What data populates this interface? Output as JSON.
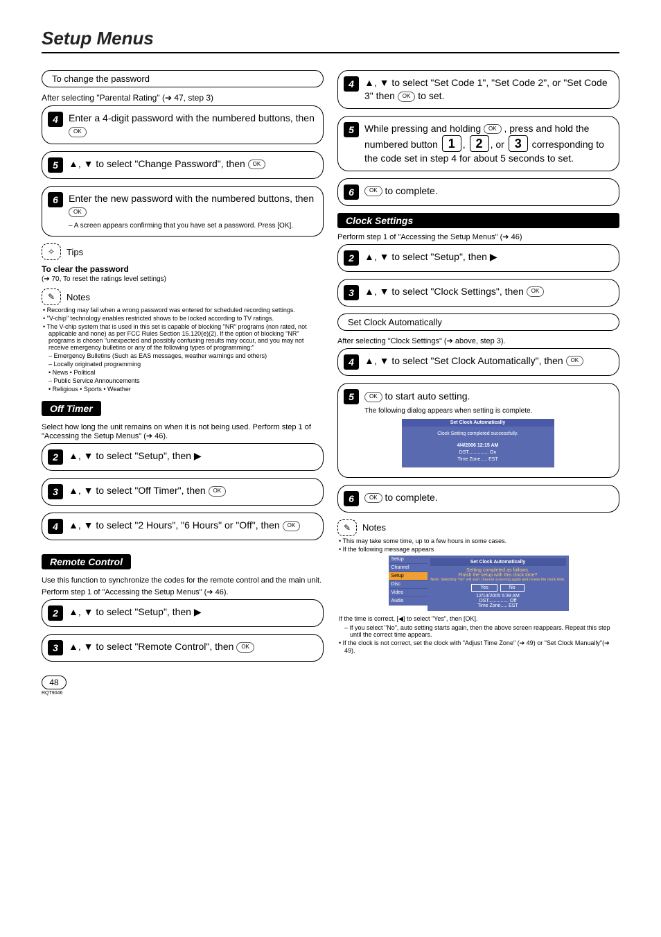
{
  "page": {
    "title": "Setup Menus",
    "number": "48",
    "footer_code": "RQT9046"
  },
  "left": {
    "change_pw_header": "To change the password",
    "change_pw_after": "After selecting \"Parental Rating\" (➔ 47, step 3)",
    "step4": "Enter a 4-digit password with the numbered buttons, then ",
    "step5": "▲, ▼ to select \"Change Password\", then ",
    "step6": "Enter the new password with the numbered buttons, then ",
    "step6_sub": "– A screen appears confirming that you have set a password. Press [OK].",
    "tips_label": "Tips",
    "tips_title": "To clear the password",
    "tips_body": "(➔ 70, To reset the ratings level settings)",
    "notes_label": "Notes",
    "notes": [
      "Recording may fail when a wrong password was entered for scheduled recording settings.",
      "\"V-chip\" technology enables restricted shows to be locked according to TV ratings.",
      "The V-chip system that is used in this set is capable of blocking \"NR\" programs (non rated, not applicable and none) as per FCC Rules Section 15.120(e)(2). If the option of blocking \"NR\" programs is chosen \"unexpected and possibly confusing results may occur, and you may not receive emergency bulletins or any of the following types of programming:\""
    ],
    "notes_sub": [
      "Emergency Bulletins (Such as EAS messages, weather warnings and others)",
      "Locally originated programming",
      "News • Political",
      "Public Service Announcements",
      "Religious • Sports • Weather"
    ],
    "off_timer_title": "Off Timer",
    "off_timer_intro": "Select how long the unit remains on when it is not being used. Perform step 1 of \"Accessing the Setup Menus\" (➔ 46).",
    "ot_step2": "▲, ▼ to select \"Setup\", then ▶",
    "ot_step3": "▲, ▼ to select \"Off Timer\", then ",
    "ot_step4": "▲, ▼ to select \"2 Hours\", \"6 Hours\" or \"Off\", then ",
    "rc_title": "Remote Control",
    "rc_intro1": "Use this function to synchronize the codes for the remote control and the main unit.",
    "rc_intro2": "Perform step 1 of \"Accessing the Setup Menus\" (➔ 46).",
    "rc_step2": "▲, ▼ to select \"Setup\", then ▶",
    "rc_step3": "▲, ▼ to select \"Remote Control\", then "
  },
  "right": {
    "step4": "▲, ▼ to select \"Set Code 1\", \"Set Code 2\", or \"Set Code 3\" then ",
    "step4_tail": " to set.",
    "step5a": "While pressing and holding ",
    "step5b": ", press and hold the numbered button ",
    "step5c": " corresponding to the code set in step 4 for about 5 seconds to set.",
    "step6": " to complete.",
    "clock_title": "Clock Settings",
    "clock_intro": "Perform step 1 of \"Accessing the Setup Menus\" (➔ 46)",
    "c_step2": "▲, ▼ to select \"Setup\", then ▶",
    "c_step3": "▲, ▼ to select \"Clock Settings\", then ",
    "sca_header": "Set Clock Automatically",
    "sca_after": "After selecting \"Clock Settings\" (➔ above, step 3).",
    "sca_step4": "▲, ▼ to select \"Set Clock Automatically\", then ",
    "sca_step5": " to start auto setting.",
    "sca_step5_sub": "The following dialog appears when setting is complete.",
    "osd1": {
      "title": "Set Clock Automatically",
      "line1": "Clock Setting completed successfully.",
      "line2": "4/4/2006 12:15 AM",
      "line3": "DST............... On",
      "line4": "Time Zone..... EST"
    },
    "sca_step6": " to complete.",
    "notes_label": "Notes",
    "notes1": "This may take some time, up to a few hours in some cases.",
    "notes2": "If the following message appears",
    "osd2": {
      "side": [
        "Setup",
        "Channel",
        "Setup",
        "Disc",
        "Video",
        "Audio"
      ],
      "title": "Set Clock Automatically",
      "l1": "Setting completed as follows.",
      "l2": "Finish the setup with this clock time?",
      "l3": "Note: Selecting \"No\" will start channel scanning again and renew the clock time.",
      "yes": "Yes",
      "no": "No",
      "l4": "12/14/2005 5:39 AM",
      "l5": "DST............... Off",
      "l6": "Time Zone..... EST"
    },
    "tail1": "If the time is correct, [◀] to select \"Yes\", then [OK].",
    "tail1_sub": "If you select \"No\", auto setting starts again, then the above screen reappears. Repeat this step until the correct time appears.",
    "tail2": "If the clock is not correct, set the clock with \"Adjust Time Zone\" (➔ 49) or \"Set Clock Manually\"(➔ 49)."
  }
}
